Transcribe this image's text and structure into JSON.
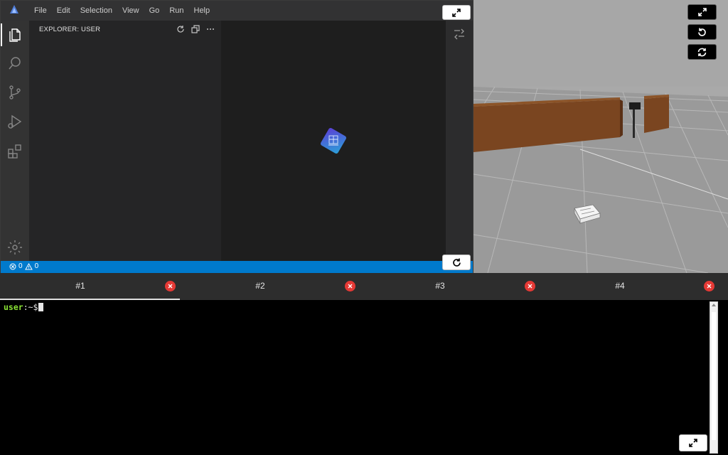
{
  "menu": [
    "File",
    "Edit",
    "Selection",
    "View",
    "Go",
    "Run",
    "Help"
  ],
  "sidebar": {
    "title": "EXPLORER: USER"
  },
  "status": {
    "errors": "0",
    "warnings": "0"
  },
  "tabs": [
    {
      "label": "#1",
      "active": true
    },
    {
      "label": "#2",
      "active": false
    },
    {
      "label": "#3",
      "active": false
    },
    {
      "label": "#4",
      "active": false
    }
  ],
  "terminal": {
    "user": "user",
    "path": ":~$"
  },
  "colors": {
    "statusbar": "#007acc",
    "tab_close": "#e53935",
    "prompt_user": "#8ae234"
  },
  "icons": {
    "activity": [
      "files-icon",
      "search-icon",
      "source-control-icon",
      "run-debug-icon",
      "extensions-icon",
      "settings-gear-icon"
    ],
    "sim_buttons": [
      "expand-icon",
      "reset-view-icon",
      "reload-sim-icon"
    ]
  }
}
